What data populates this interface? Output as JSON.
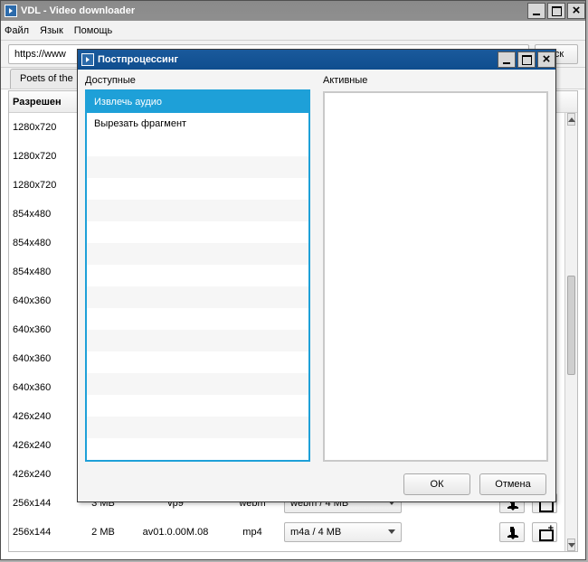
{
  "main_window": {
    "title": "VDL - Video downloader",
    "menu": {
      "file": "Файл",
      "lang": "Язык",
      "help": "Помощь"
    },
    "url": "https://www",
    "go_partial": "иск",
    "tab": "Poets of the",
    "header_col": "Разрешен",
    "rows": [
      {
        "res": "1280x720"
      },
      {
        "res": "1280x720"
      },
      {
        "res": "1280x720"
      },
      {
        "res": "854x480"
      },
      {
        "res": "854x480"
      },
      {
        "res": "854x480"
      },
      {
        "res": "640x360"
      },
      {
        "res": "640x360"
      },
      {
        "res": "640x360"
      },
      {
        "res": "640x360"
      },
      {
        "res": "426x240"
      },
      {
        "res": "426x240"
      },
      {
        "res": "426x240"
      },
      {
        "res": "256x144",
        "size": "3 MB",
        "codec": "vp9",
        "ext": "webm",
        "combo": "webm / 4 MB"
      },
      {
        "res": "256x144",
        "size": "2 MB",
        "codec": "av01.0.00M.08",
        "ext": "mp4",
        "combo": "m4a / 4 MB"
      }
    ]
  },
  "dialog": {
    "title": "Постпроцессинг",
    "left_title": "Доступные",
    "right_title": "Активные",
    "available": [
      "Извлечь аудио",
      "Вырезать фрагмент"
    ],
    "selected_index": 0,
    "ok": "ОК",
    "cancel": "Отмена"
  }
}
